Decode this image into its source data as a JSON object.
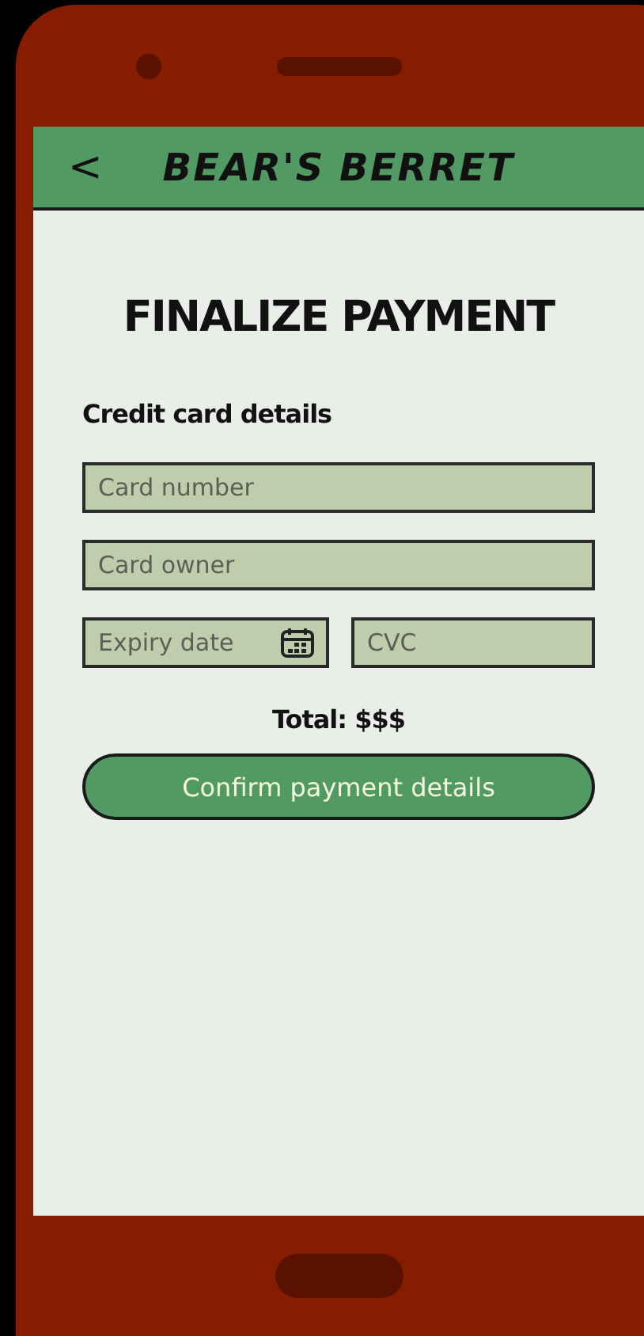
{
  "header": {
    "back": "<",
    "title": "BEAR'S BERRET"
  },
  "page_title": "FINALIZE PAYMENT",
  "section_label": "Credit card details",
  "fields": [
    {
      "kind": "full",
      "placeholder": "Card number"
    },
    {
      "kind": "full",
      "placeholder": "Card owner"
    },
    {
      "kind": "date",
      "placeholder": "Expiry date"
    },
    {
      "kind": "half",
      "placeholder": "CVC"
    }
  ],
  "total": "Total: $$$",
  "confirm_button": "Confirm payment details"
}
